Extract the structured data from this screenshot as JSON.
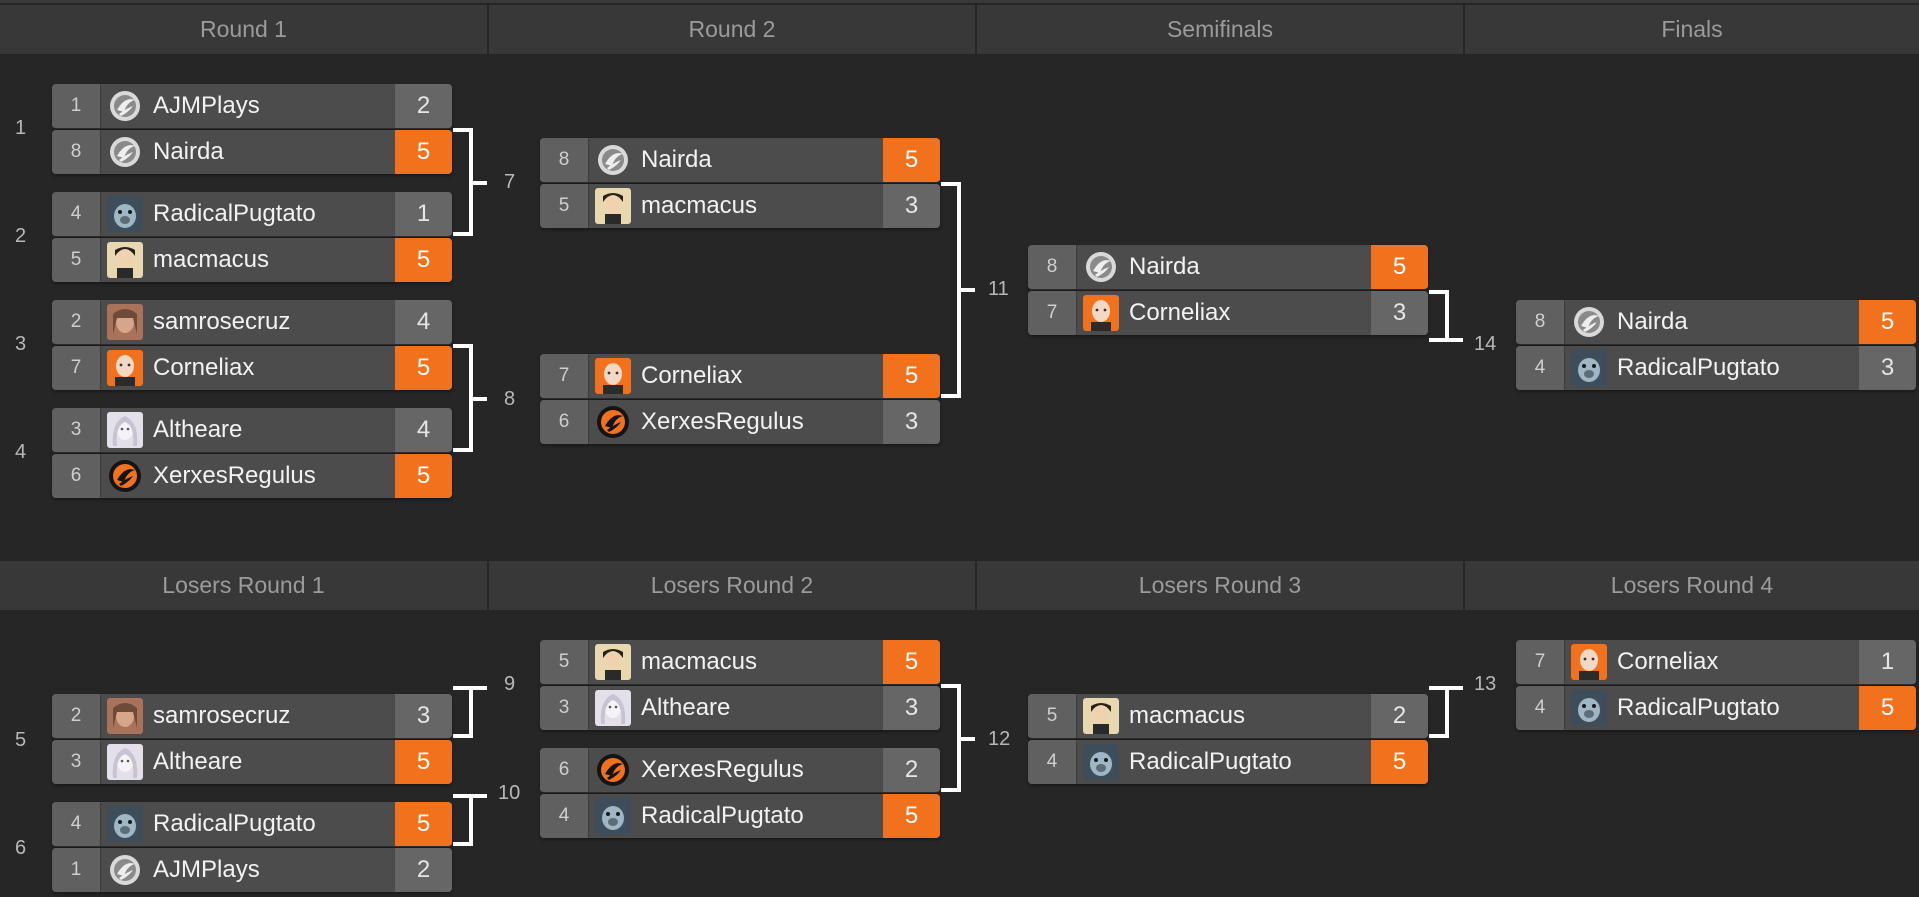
{
  "headers": {
    "round1": "Round 1",
    "round2": "Round 2",
    "semifinals": "Semifinals",
    "finals": "Finals",
    "losers1": "Losers Round 1",
    "losers2": "Losers Round 2",
    "losers3": "Losers Round 3",
    "losers4": "Losers Round 4"
  },
  "colors": {
    "win": "#f2711c",
    "background": "#262626"
  },
  "matches": {
    "m1": {
      "id": "1",
      "p1": {
        "seed": "1",
        "name": "AJMPlays",
        "score": "2",
        "win": false,
        "avatar": "swirl-logo-icon"
      },
      "p2": {
        "seed": "8",
        "name": "Nairda",
        "score": "5",
        "win": true,
        "avatar": "swirl-logo-icon"
      }
    },
    "m2": {
      "id": "2",
      "p1": {
        "seed": "4",
        "name": "RadicalPugtato",
        "score": "1",
        "win": false,
        "avatar": "pug-avatar"
      },
      "p2": {
        "seed": "5",
        "name": "macmacus",
        "score": "5",
        "win": true,
        "avatar": "anime-avatar"
      }
    },
    "m3": {
      "id": "3",
      "p1": {
        "seed": "2",
        "name": "samrosecruz",
        "score": "4",
        "win": false,
        "avatar": "photo-avatar"
      },
      "p2": {
        "seed": "7",
        "name": "Corneliax",
        "score": "5",
        "win": true,
        "avatar": "bald-avatar"
      }
    },
    "m4": {
      "id": "4",
      "p1": {
        "seed": "3",
        "name": "Altheare",
        "score": "4",
        "win": false,
        "avatar": "sketch-avatar"
      },
      "p2": {
        "seed": "6",
        "name": "XerxesRegulus",
        "score": "5",
        "win": true,
        "avatar": "orange-logo-icon"
      }
    },
    "m7": {
      "id": "7",
      "p1": {
        "seed": "8",
        "name": "Nairda",
        "score": "5",
        "win": true,
        "avatar": "swirl-logo-icon"
      },
      "p2": {
        "seed": "5",
        "name": "macmacus",
        "score": "3",
        "win": false,
        "avatar": "anime-avatar"
      }
    },
    "m8": {
      "id": "8",
      "p1": {
        "seed": "7",
        "name": "Corneliax",
        "score": "5",
        "win": true,
        "avatar": "bald-avatar"
      },
      "p2": {
        "seed": "6",
        "name": "XerxesRegulus",
        "score": "3",
        "win": false,
        "avatar": "orange-logo-icon"
      }
    },
    "m11": {
      "id": "11",
      "p1": {
        "seed": "8",
        "name": "Nairda",
        "score": "5",
        "win": true,
        "avatar": "swirl-logo-icon"
      },
      "p2": {
        "seed": "7",
        "name": "Corneliax",
        "score": "3",
        "win": false,
        "avatar": "bald-avatar"
      }
    },
    "m14": {
      "id": "14",
      "p1": {
        "seed": "8",
        "name": "Nairda",
        "score": "5",
        "win": true,
        "avatar": "swirl-logo-icon"
      },
      "p2": {
        "seed": "4",
        "name": "RadicalPugtato",
        "score": "3",
        "win": false,
        "avatar": "pug-avatar"
      }
    },
    "m5": {
      "id": "5",
      "p1": {
        "seed": "2",
        "name": "samrosecruz",
        "score": "3",
        "win": false,
        "avatar": "photo-avatar"
      },
      "p2": {
        "seed": "3",
        "name": "Altheare",
        "score": "5",
        "win": true,
        "avatar": "sketch-avatar"
      }
    },
    "m6": {
      "id": "6",
      "p1": {
        "seed": "4",
        "name": "RadicalPugtato",
        "score": "5",
        "win": true,
        "avatar": "pug-avatar"
      },
      "p2": {
        "seed": "1",
        "name": "AJMPlays",
        "score": "2",
        "win": false,
        "avatar": "swirl-logo-icon"
      }
    },
    "m9": {
      "id": "9",
      "p1": {
        "seed": "5",
        "name": "macmacus",
        "score": "5",
        "win": true,
        "avatar": "anime-avatar"
      },
      "p2": {
        "seed": "3",
        "name": "Altheare",
        "score": "3",
        "win": false,
        "avatar": "sketch-avatar"
      }
    },
    "m10": {
      "id": "10",
      "p1": {
        "seed": "6",
        "name": "XerxesRegulus",
        "score": "2",
        "win": false,
        "avatar": "orange-logo-icon"
      },
      "p2": {
        "seed": "4",
        "name": "RadicalPugtato",
        "score": "5",
        "win": true,
        "avatar": "pug-avatar"
      }
    },
    "m12": {
      "id": "12",
      "p1": {
        "seed": "5",
        "name": "macmacus",
        "score": "2",
        "win": false,
        "avatar": "anime-avatar"
      },
      "p2": {
        "seed": "4",
        "name": "RadicalPugtato",
        "score": "5",
        "win": true,
        "avatar": "pug-avatar"
      }
    },
    "m13": {
      "id": "13",
      "p1": {
        "seed": "7",
        "name": "Corneliax",
        "score": "1",
        "win": false,
        "avatar": "bald-avatar"
      },
      "p2": {
        "seed": "4",
        "name": "RadicalPugtato",
        "score": "5",
        "win": true,
        "avatar": "pug-avatar"
      }
    }
  }
}
